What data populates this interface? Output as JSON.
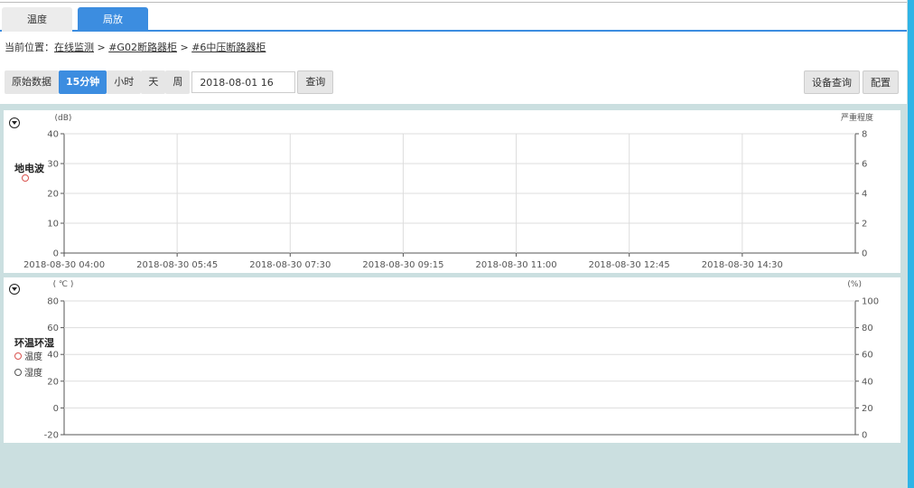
{
  "tabs": [
    {
      "label": "温度",
      "active": false
    },
    {
      "label": "局放",
      "active": true
    }
  ],
  "breadcrumb": {
    "prefix": "当前位置：",
    "items": [
      "在线监测",
      "#G02断路器柜",
      "#6中压断路器柜"
    ],
    "separator": " > "
  },
  "toolbar": {
    "raw_data": "原始数据",
    "min15": "15分钟",
    "hour": "小时",
    "day": "天",
    "week": "周",
    "date_value": "2018-08-01 16",
    "query": "查询",
    "device_query": "设备查询",
    "config": "配置"
  },
  "chart_data": [
    {
      "type": "line",
      "title": "地电波",
      "ylabel": "(dB)",
      "y2label": "严重程度",
      "x": [
        "2018-08-30 04:00",
        "2018-08-30 05:45",
        "2018-08-30 07:30",
        "2018-08-30 09:15",
        "2018-08-30 11:00",
        "2018-08-30 12:45",
        "2018-08-30 14:30"
      ],
      "ylim": [
        0,
        40
      ],
      "yticks": [
        "40",
        "30",
        "20",
        "10",
        "0"
      ],
      "y2lim": [
        0,
        8
      ],
      "y2ticks": [
        "8",
        "6",
        "4",
        "2",
        "0"
      ],
      "series": [
        {
          "name": "",
          "values": [],
          "color": "#d9534f"
        }
      ],
      "grid": true
    },
    {
      "type": "line",
      "title": "环温环湿",
      "ylabel": "( ℃ )",
      "y2label": "(%)",
      "ylim": [
        -20,
        80
      ],
      "yticks": [
        "80",
        "60",
        "40",
        "20",
        "0",
        "-20"
      ],
      "y2lim": [
        0,
        100
      ],
      "y2ticks": [
        "100",
        "80",
        "60",
        "40",
        "20",
        "0"
      ],
      "series": [
        {
          "name": "温度",
          "values": [],
          "color": "#d9534f"
        },
        {
          "name": "湿度",
          "values": [],
          "color": "#555555"
        }
      ],
      "grid": true
    }
  ]
}
